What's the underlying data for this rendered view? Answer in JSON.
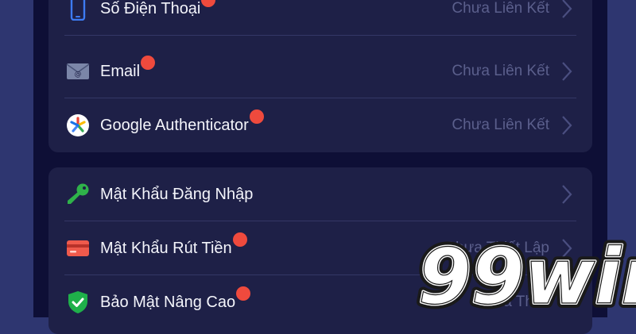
{
  "accounts": {
    "rows": [
      {
        "label": "Số Điện Thoại",
        "status": "Chưa Liên Kết",
        "icon": "phone-icon",
        "dot": true
      },
      {
        "label": "Email",
        "status": "Chưa Liên Kết",
        "icon": "email-icon",
        "dot": true
      },
      {
        "label": "Google Authenticator",
        "status": "Chưa Liên Kết",
        "icon": "google-authenticator-icon",
        "dot": true
      }
    ]
  },
  "security": {
    "rows": [
      {
        "label": "Mật Khẩu Đăng Nhập",
        "status": "",
        "icon": "key-icon",
        "dot": false
      },
      {
        "label": "Mật Khẩu Rút Tiền",
        "status": "Chưa Thiết Lập",
        "icon": "card-icon",
        "dot": true
      },
      {
        "label": "Bảo Mật Nâng Cao",
        "status": "Chưa Thiết",
        "icon": "shield-check-icon",
        "dot": true
      }
    ]
  },
  "colors": {
    "background": "#2e3670",
    "panel": "#0e0f36",
    "card": "#1e2047",
    "notification_dot": "#ef4a3d",
    "status_text": "#5b5f8c"
  },
  "watermark": {
    "logo_text": "99win"
  }
}
